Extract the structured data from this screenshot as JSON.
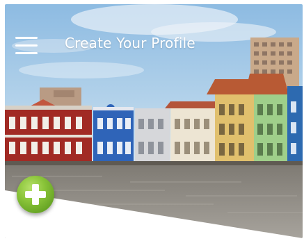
{
  "header": {
    "title": "Create Your Profile"
  },
  "icons": {
    "menu": "hamburger-menu-icon",
    "add": "plus-icon"
  },
  "colors": {
    "title_text": "#ffffff",
    "add_button": "#6aaa24",
    "sky": "#9fc6e6",
    "water": "#8e8a84"
  }
}
